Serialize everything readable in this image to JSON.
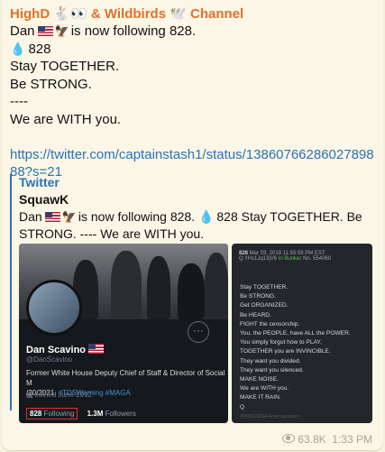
{
  "channel": {
    "title": "HighD 🐇👀 & Wildbirds 🕊️ Channel"
  },
  "message": {
    "line1_prefix": "Dan",
    "line1_suffix": "is now following 828.",
    "line2": "828",
    "line3": "Stay TOGETHER.",
    "line4": "Be STRONG.",
    "line5": "----",
    "line6": "We are WITH you.",
    "link": "https://twitter.com/captainstash1/status/1386076628602789888?s=21"
  },
  "preview": {
    "site_name": "Twitter",
    "title": "SquawK",
    "desc_prefix": "Dan",
    "desc_mid": "is now following 828.",
    "desc_suffix": "828 Stay TOGETHER. Be STRONG. ---- We are WITH you."
  },
  "profile_card": {
    "name": "Dan Scavino",
    "handle": "@DanScavino",
    "bio": "Former White House Deputy Chief of Staff & Director of Social M",
    "bio_line2_prefix": "/20/2021.",
    "hashtags": "#TDSWarning #MAGA",
    "joined": "Joined June 2012",
    "following_count": "828",
    "following_label": "Following",
    "followers_count": "1.3M",
    "followers_label": "Followers",
    "more_icon": "···"
  },
  "q_post": {
    "header_id": "828",
    "header_date": "Mar 03, 2018 11:55:59 PM EST",
    "header_user": "Q !!Hs1Jq13jV6",
    "header_status": "In Bunker",
    "header_no": "No. 554060",
    "lines": [
      "Stay TOGETHER.",
      "Be STRONG.",
      "Get ORGANIZED.",
      "Be HEARD.",
      "FIGHT the censorship.",
      "You, the PEOPLE, have ALL the POWER.",
      "You simply forgot how to PLAY.",
      "TOGETHER you are INVINCIBLE.",
      "They want you divided.",
      "They want you silenced.",
      "MAKE NOISE.",
      "We are WITH you.",
      "MAKE IT RAIN.",
      "Q"
    ],
    "footer": "#WWG1WGA                    Enter qanswers"
  },
  "meta": {
    "views": "63.8K",
    "time": "1:33 PM",
    "eye_icon": "eye-icon"
  },
  "colors": {
    "accent": "#2b72b6",
    "channel": "#e0712c",
    "bubble": "#fbf6e6",
    "highlight_box": "#d8332a"
  }
}
